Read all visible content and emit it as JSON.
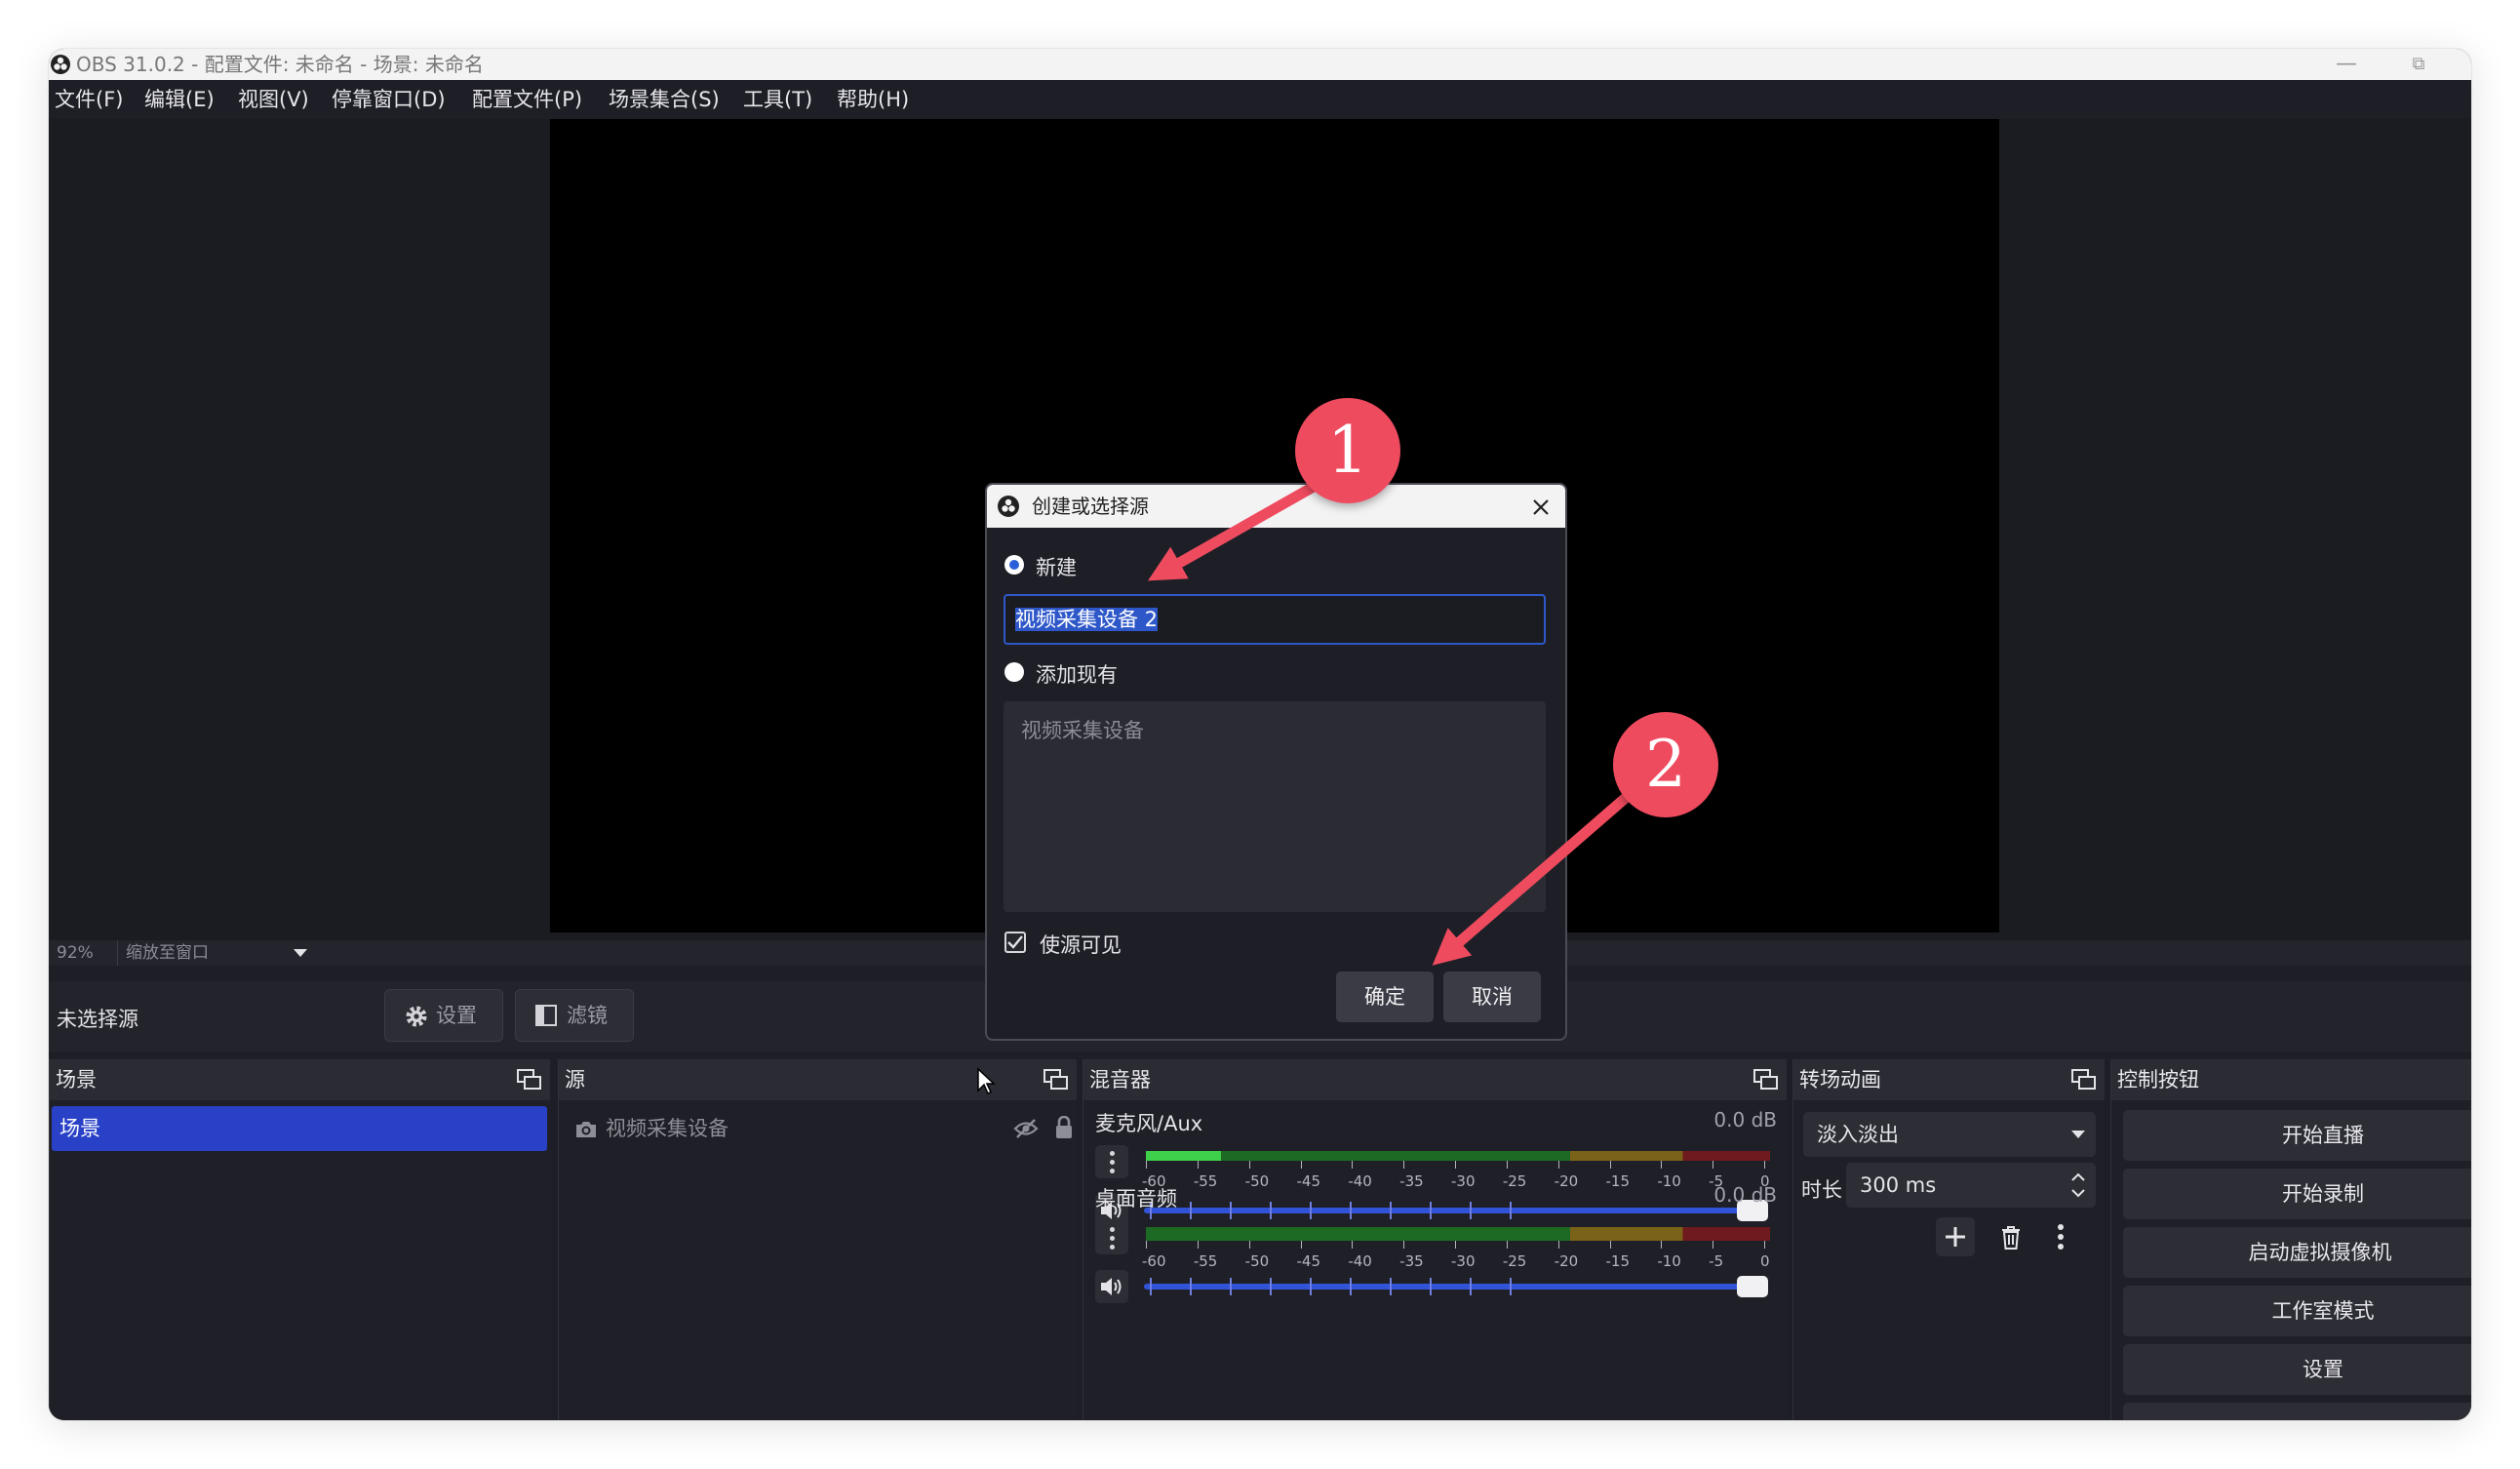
{
  "window": {
    "title": "OBS 31.0.2 - 配置文件: 未命名 - 场景: 未命名",
    "minimize_glyph": "—",
    "restore_glyph": "⧉"
  },
  "menu": [
    "文件(F)",
    "编辑(E)",
    "视图(V)",
    "停靠窗口(D)",
    "配置文件(P)",
    "场景集合(S)",
    "工具(T)",
    "帮助(H)"
  ],
  "zoom": {
    "percent": "92%",
    "mode": "缩放至窗口"
  },
  "source_toolbar": {
    "no_source_label": "未选择源",
    "settings_label": "设置",
    "filters_label": "滤镜"
  },
  "docks": {
    "scenes": {
      "title": "场景",
      "items": [
        "场景"
      ]
    },
    "sources": {
      "title": "源",
      "items": [
        "视频采集设备"
      ]
    },
    "mixer": {
      "title": "混音器",
      "channels": [
        {
          "name": "麦克风/Aux",
          "db": "0.0 dB",
          "level": 0.12
        },
        {
          "name": "桌面音频",
          "db": "0.0 dB",
          "level": 0.0
        }
      ],
      "scale": [
        "-60",
        "-55",
        "-50",
        "-45",
        "-40",
        "-35",
        "-30",
        "-25",
        "-20",
        "-15",
        "-10",
        "-5",
        "0"
      ]
    },
    "transitions": {
      "title": "转场动画",
      "selected": "淡入淡出",
      "duration_label": "时长",
      "duration_value": "300 ms"
    },
    "controls": {
      "title": "控制按钮",
      "buttons": [
        "开始直播",
        "开始录制",
        "启动虚拟摄像机",
        "工作室模式",
        "设置"
      ]
    }
  },
  "dialog": {
    "title": "创建或选择源",
    "create_new_label": "新建",
    "name_value": "视频采集设备 2",
    "add_existing_label": "添加现有",
    "existing_items": [
      "视频采集设备"
    ],
    "visible_label": "使源可见",
    "ok_label": "确定",
    "cancel_label": "取消"
  },
  "annotations": {
    "callout_1": "1",
    "callout_2": "2",
    "color": "#ef4b5f"
  },
  "colors": {
    "accent": "#2941c7",
    "background": "#1e1f26",
    "dock_header": "#2a2b33"
  }
}
